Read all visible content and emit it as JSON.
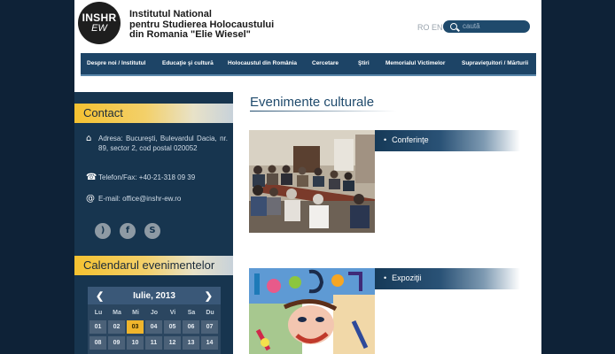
{
  "header": {
    "logo_line1": "INSHR",
    "logo_line2": "EW",
    "institute_lines": [
      "Institutul National",
      "pentru Studierea Holocaustului",
      "din Romania \"Elie Wiesel\""
    ],
    "languages": "RO EN",
    "search_placeholder": "caută"
  },
  "nav": {
    "items": [
      "Despre noi / Institutul",
      "Educaţie şi cultură",
      "Holocaustul din România",
      "Cercetare",
      "Ştiri",
      "Memorialul Victimelor",
      "Supravieţuitori / Mărturii"
    ]
  },
  "sidebar": {
    "contact_title": "Contact",
    "address": "Adresa: Bucureşti, Bulevardul Dacia, nr. 89, sector 2, cod postal 020052",
    "phone": "Telefon/Fax: +40-21-318 09 39",
    "email": "E-mail: office@inshr-ew.ro",
    "social_icons": [
      "rss-icon",
      "facebook-icon",
      "skype-icon"
    ],
    "calendar_title": "Calendarul evenimentelor",
    "calendar": {
      "month": "Iulie, 2013",
      "prev": "❮",
      "next": "❯",
      "weekdays": [
        "Lu",
        "Ma",
        "Mi",
        "Jo",
        "Vi",
        "Sa",
        "Du"
      ],
      "week1": [
        "01",
        "02",
        "03",
        "04",
        "05",
        "06",
        "07"
      ],
      "week2": [
        "08",
        "09",
        "10",
        "11",
        "12",
        "13",
        "14"
      ],
      "selected_day": "03"
    }
  },
  "main": {
    "title": "Evenimente culturale",
    "categories": [
      "Conferinţe",
      "Expoziţii"
    ]
  },
  "colors": {
    "background": "#0e2237",
    "navy": "#1d4466",
    "accent_yellow": "#f5c231"
  }
}
